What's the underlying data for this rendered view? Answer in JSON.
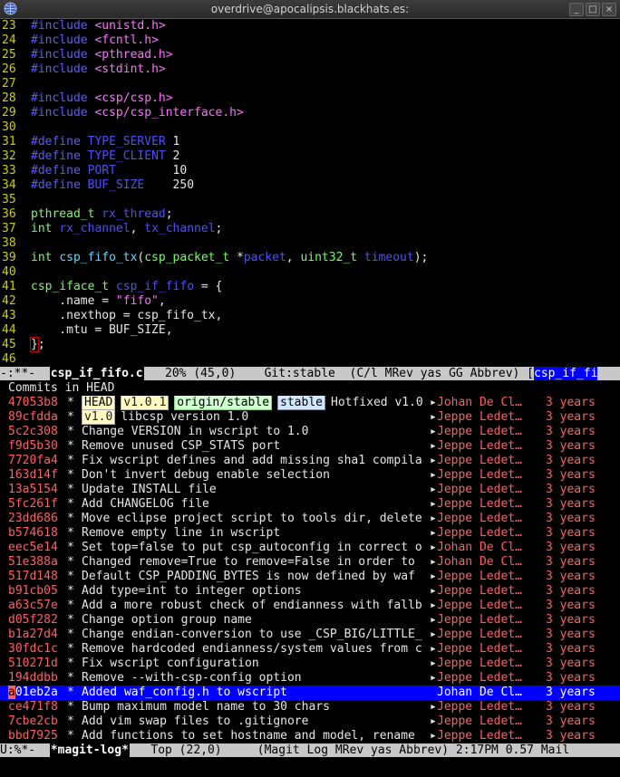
{
  "window": {
    "title": "overdrive@apocalipsis.blackhats.es:"
  },
  "code": [
    {
      "n": "23",
      "t": [
        [
          "pp",
          "#include "
        ],
        [
          "str",
          "<unistd.h>"
        ]
      ]
    },
    {
      "n": "24",
      "t": [
        [
          "pp",
          "#include "
        ],
        [
          "str",
          "<fcntl.h>"
        ]
      ]
    },
    {
      "n": "25",
      "t": [
        [
          "pp",
          "#include "
        ],
        [
          "str",
          "<pthread.h>"
        ]
      ]
    },
    {
      "n": "26",
      "t": [
        [
          "pp",
          "#include "
        ],
        [
          "str",
          "<stdint.h>"
        ]
      ]
    },
    {
      "n": "27",
      "t": []
    },
    {
      "n": "28",
      "t": [
        [
          "pp",
          "#include "
        ],
        [
          "str",
          "<csp/csp.h>"
        ]
      ]
    },
    {
      "n": "29",
      "t": [
        [
          "pp",
          "#include "
        ],
        [
          "str",
          "<csp/csp_interface.h>"
        ]
      ]
    },
    {
      "n": "30",
      "t": []
    },
    {
      "n": "31",
      "t": [
        [
          "pp",
          "#define "
        ],
        [
          "var",
          "TYPE_SERVER "
        ],
        [
          "num",
          "1"
        ]
      ]
    },
    {
      "n": "32",
      "t": [
        [
          "pp",
          "#define "
        ],
        [
          "var",
          "TYPE_CLIENT "
        ],
        [
          "num",
          "2"
        ]
      ]
    },
    {
      "n": "33",
      "t": [
        [
          "pp",
          "#define "
        ],
        [
          "var",
          "PORT        "
        ],
        [
          "num",
          "10"
        ]
      ]
    },
    {
      "n": "34",
      "t": [
        [
          "pp",
          "#define "
        ],
        [
          "var",
          "BUF_SIZE    "
        ],
        [
          "num",
          "250"
        ]
      ]
    },
    {
      "n": "35",
      "t": []
    },
    {
      "n": "36",
      "t": [
        [
          "ty",
          "pthread_t "
        ],
        [
          "var",
          "rx_thread"
        ],
        [
          "num",
          ";"
        ]
      ]
    },
    {
      "n": "37",
      "t": [
        [
          "ty",
          "int "
        ],
        [
          "var",
          "rx_channel"
        ],
        [
          "num",
          ", "
        ],
        [
          "var",
          "tx_channel"
        ],
        [
          "num",
          ";"
        ]
      ]
    },
    {
      "n": "38",
      "t": []
    },
    {
      "n": "39",
      "t": [
        [
          "ty",
          "int "
        ],
        [
          "fn",
          "csp_fifo_tx"
        ],
        [
          "num",
          "("
        ],
        [
          "ty",
          "csp_packet_t "
        ],
        [
          "num",
          "*"
        ],
        [
          "var",
          "packet"
        ],
        [
          "num",
          ", "
        ],
        [
          "ty",
          "uint32_t "
        ],
        [
          "var",
          "timeout"
        ],
        [
          "num",
          ");"
        ]
      ]
    },
    {
      "n": "40",
      "t": []
    },
    {
      "n": "41",
      "t": [
        [
          "ty",
          "csp_iface_t "
        ],
        [
          "var",
          "csp_if_fifo"
        ],
        [
          "num",
          " = {"
        ]
      ]
    },
    {
      "n": "42",
      "t": [
        [
          "num",
          "    .name = "
        ],
        [
          "str",
          "\"fifo\""
        ],
        [
          "num",
          ","
        ]
      ]
    },
    {
      "n": "43",
      "t": [
        [
          "num",
          "    .nexthop = csp_fifo_tx,"
        ]
      ]
    },
    {
      "n": "44",
      "t": [
        [
          "num",
          "    .mtu = BUF_SIZE,"
        ]
      ]
    },
    {
      "n": "45",
      "t": [
        [
          "brk",
          "}"
        ],
        [
          "num",
          ";"
        ]
      ]
    },
    {
      "n": "46",
      "t": []
    }
  ],
  "modeline_top": {
    "left": "-:**-  ",
    "buffer": "csp_if_fifo.c",
    "middle": "   20% (45,0)    Git:stable  (C/l MRev yas GG Abbrev) [",
    "right": "csp_if_fi"
  },
  "log": {
    "header": "Commits in HEAD",
    "rows": [
      {
        "hash": "47053b8",
        "refs": [
          {
            "label": "HEAD",
            "kind": "head"
          },
          {
            "label": "v1.0.1",
            "kind": "tag"
          },
          {
            "label": "origin/stable",
            "kind": "remote"
          },
          {
            "label": "stable",
            "kind": "branch"
          }
        ],
        "msg": "Hotfixed v1.0.1",
        "author": "Johan De Cl…",
        "age": "3 years"
      },
      {
        "hash": "89cfdda",
        "refs": [
          {
            "label": "v1.0",
            "kind": "tag"
          }
        ],
        "msg": "libcsp version 1.0",
        "author": "Jeppe Ledet…",
        "age": "3 years"
      },
      {
        "hash": "5c2c308",
        "refs": [],
        "msg": "Change VERSION in wscript to 1.0",
        "author": "Jeppe Ledet…",
        "age": "3 years"
      },
      {
        "hash": "f9d5b30",
        "refs": [],
        "msg": "Remove unused CSP_STATS port",
        "author": "Jeppe Ledet…",
        "age": "3 years"
      },
      {
        "hash": "7720fa4",
        "refs": [],
        "msg": "Fix wscript defines and add missing sha1 compila",
        "author": "Jeppe Ledet…",
        "age": "3 years"
      },
      {
        "hash": "163d14f",
        "refs": [],
        "msg": "Don't invert debug enable selection",
        "author": "Jeppe Ledet…",
        "age": "3 years"
      },
      {
        "hash": "13a5154",
        "refs": [],
        "msg": "Update INSTALL file",
        "author": "Jeppe Ledet…",
        "age": "3 years"
      },
      {
        "hash": "5fc261f",
        "refs": [],
        "msg": "Add CHANGELOG file",
        "author": "Jeppe Ledet…",
        "age": "3 years"
      },
      {
        "hash": "23dd686",
        "refs": [],
        "msg": "Move eclipse project script to tools dir, delete",
        "author": "Jeppe Ledet…",
        "age": "3 years"
      },
      {
        "hash": "b574618",
        "refs": [],
        "msg": "Remove empty line in wscript",
        "author": "Jeppe Ledet…",
        "age": "3 years"
      },
      {
        "hash": "eec5e14",
        "refs": [],
        "msg": "Set top=false to put csp_autoconfig in correct o",
        "author": "Johan De Cl…",
        "age": "3 years"
      },
      {
        "hash": "51e388a",
        "refs": [],
        "msg": "Changed remove=True to remove=False in order to",
        "author": "Johan De Cl…",
        "age": "3 years"
      },
      {
        "hash": "517d148",
        "refs": [],
        "msg": "Default CSP_PADDING_BYTES is now defined by waf",
        "author": "Jeppe Ledet…",
        "age": "3 years"
      },
      {
        "hash": "b91cb05",
        "refs": [],
        "msg": "Add type=int to integer options",
        "author": "Jeppe Ledet…",
        "age": "3 years"
      },
      {
        "hash": "a63c57e",
        "refs": [],
        "msg": "Add a more robust check of endianness with fallb",
        "author": "Jeppe Ledet…",
        "age": "3 years"
      },
      {
        "hash": "d05f282",
        "refs": [],
        "msg": "Change option group name",
        "author": "Jeppe Ledet…",
        "age": "3 years"
      },
      {
        "hash": "b1a27d4",
        "refs": [],
        "msg": "Change endian-conversion to use _CSP_BIG/LITTLE_",
        "author": "Jeppe Ledet…",
        "age": "3 years"
      },
      {
        "hash": "30fdc1c",
        "refs": [],
        "msg": "Remove hardcoded endianness/system values from c",
        "author": "Jeppe Ledet…",
        "age": "3 years"
      },
      {
        "hash": "510271d",
        "refs": [],
        "msg": "Fix wscript configuration",
        "author": "Jeppe Ledet…",
        "age": "3 years"
      },
      {
        "hash": "194ddbb",
        "refs": [],
        "msg": "Remove --with-csp-config option",
        "author": "Jeppe Ledet…",
        "age": "3 years"
      },
      {
        "hash": "a01eb2a",
        "refs": [],
        "msg": "Added waf_config.h to wscript",
        "author": "Johan De Cl…",
        "age": "3 years",
        "selected": true
      },
      {
        "hash": "ce471f8",
        "refs": [],
        "msg": "Bump maximum model name to 30 chars",
        "author": "Jeppe Ledet…",
        "age": "3 years"
      },
      {
        "hash": "7cbe2cb",
        "refs": [],
        "msg": "Add vim swap files to .gitignore",
        "author": "Jeppe Ledet…",
        "age": "3 years"
      },
      {
        "hash": "bbd7925",
        "refs": [],
        "msg": "Add functions to set hostname and model, rename",
        "author": "Jeppe Ledet…",
        "age": "3 years"
      }
    ]
  },
  "modeline_bottom": {
    "left": "U:%*-  ",
    "buffer": "*magit-log*",
    "rest": "   Top (22,0)     (Magit Log MRev yas Abbrev) 2:17PM 0.57 Mail"
  },
  "colors": {
    "selection": "#0000ff",
    "hash": "#ff5f5f",
    "line_number": "#cfcf00"
  }
}
